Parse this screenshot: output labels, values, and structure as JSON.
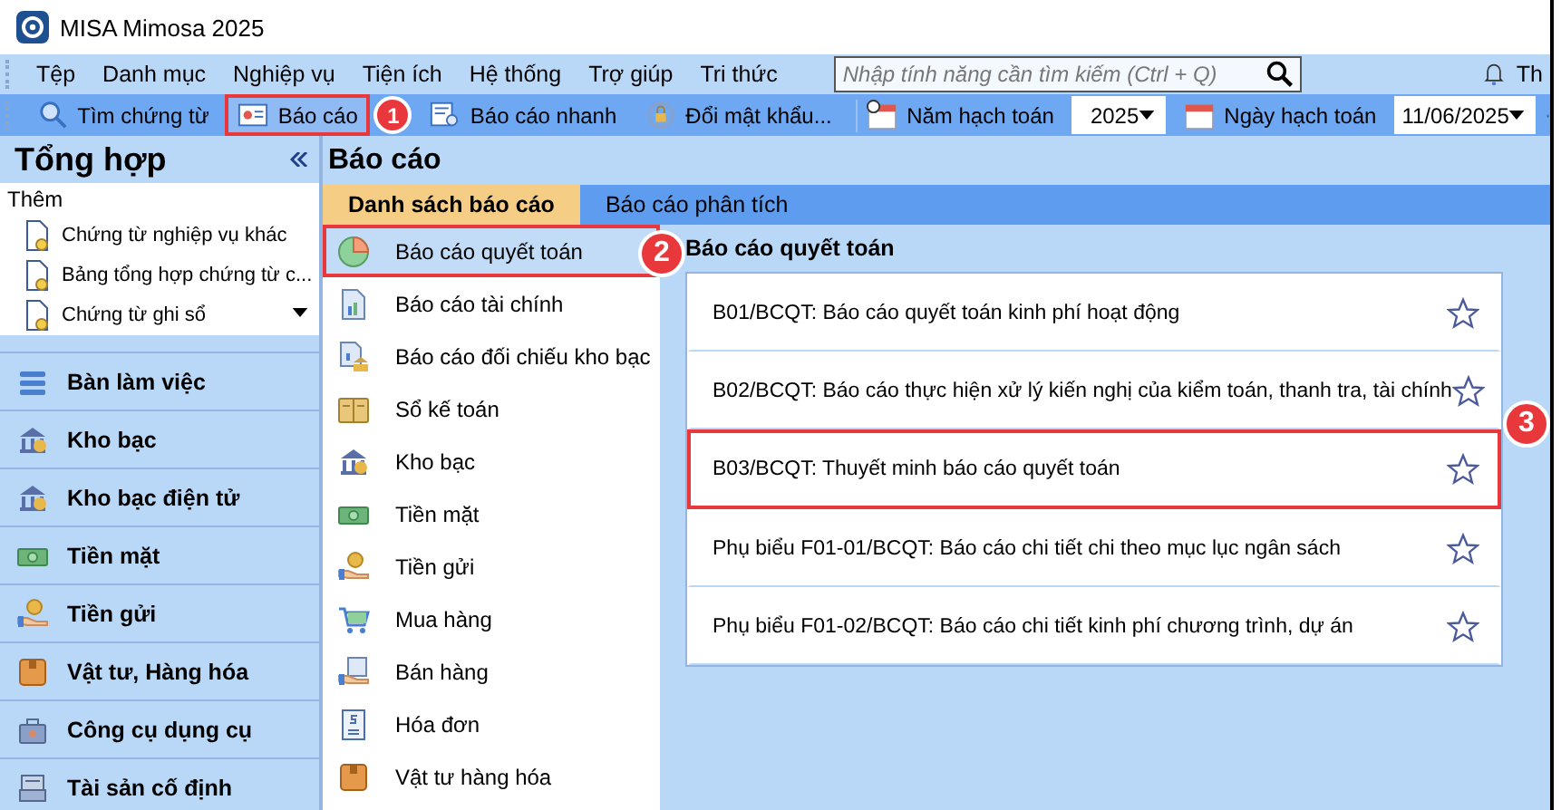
{
  "window": {
    "title": "MISA Mimosa 2025"
  },
  "menu": [
    "Tệp",
    "Danh mục",
    "Nghiệp vụ",
    "Tiện ích",
    "Hệ thống",
    "Trợ giúp",
    "Tri thức"
  ],
  "search": {
    "placeholder": "Nhập tính năng cần tìm kiếm (Ctrl + Q)"
  },
  "menu_right": "Th",
  "toolbar": [
    {
      "label": "Tìm chứng từ",
      "highlighted": false
    },
    {
      "label": "Báo cáo",
      "highlighted": true,
      "callout": "1"
    },
    {
      "label": "Báo cáo nhanh",
      "highlighted": false
    },
    {
      "label": "Đổi mật khẩu...",
      "highlighted": false
    }
  ],
  "year": {
    "label": "Năm hạch toán",
    "value": "2025"
  },
  "date": {
    "label": "Ngày hạch toán",
    "value": "11/06/2025"
  },
  "sidebar": {
    "title": "Tổng hợp",
    "section": "Thêm",
    "recent": [
      "Chứng từ nghiệp vụ khác",
      "Bảng tổng hợp chứng từ c...",
      "Chứng từ ghi sổ"
    ],
    "items": [
      "Bàn làm việc",
      "Kho bạc",
      "Kho bạc điện tử",
      "Tiền mặt",
      "Tiền gửi",
      "Vật tư, Hàng hóa",
      "Công cụ dụng cụ",
      "Tài sản cố định"
    ]
  },
  "main": {
    "title": "Báo cáo",
    "tabs": [
      {
        "label": "Danh sách báo cáo",
        "selected": true
      },
      {
        "label": "Báo cáo phân tích",
        "selected": false
      }
    ],
    "categories": [
      {
        "label": "Báo cáo quyết toán",
        "selected": true,
        "callout": "2"
      },
      {
        "label": "Báo cáo tài chính",
        "selected": false
      },
      {
        "label": "Báo cáo đối chiếu kho bạc",
        "selected": false
      },
      {
        "label": "Sổ kế toán",
        "selected": false
      },
      {
        "label": "Kho bạc",
        "selected": false
      },
      {
        "label": "Tiền mặt",
        "selected": false
      },
      {
        "label": "Tiền gửi",
        "selected": false
      },
      {
        "label": "Mua hàng",
        "selected": false
      },
      {
        "label": "Bán hàng",
        "selected": false
      },
      {
        "label": "Hóa đơn",
        "selected": false
      },
      {
        "label": "Vật tư hàng hóa",
        "selected": false
      }
    ],
    "group_title": "Báo cáo quyết toán",
    "reports": [
      {
        "label": "B01/BCQT: Báo cáo quyết toán kinh phí hoạt động",
        "highlighted": false
      },
      {
        "label": "B02/BCQT: Báo cáo thực hiện xử lý kiến nghị của kiểm toán, thanh tra, tài chính",
        "highlighted": false
      },
      {
        "label": "B03/BCQT: Thuyết minh báo cáo quyết toán",
        "highlighted": true,
        "callout": "3"
      },
      {
        "label": "Phụ biểu F01-01/BCQT: Báo cáo chi tiết chi theo mục lục ngân sách",
        "highlighted": false
      },
      {
        "label": "Phụ biểu F01-02/BCQT: Báo cáo chi tiết kinh phí chương trình, dự án",
        "highlighted": false
      }
    ]
  }
}
